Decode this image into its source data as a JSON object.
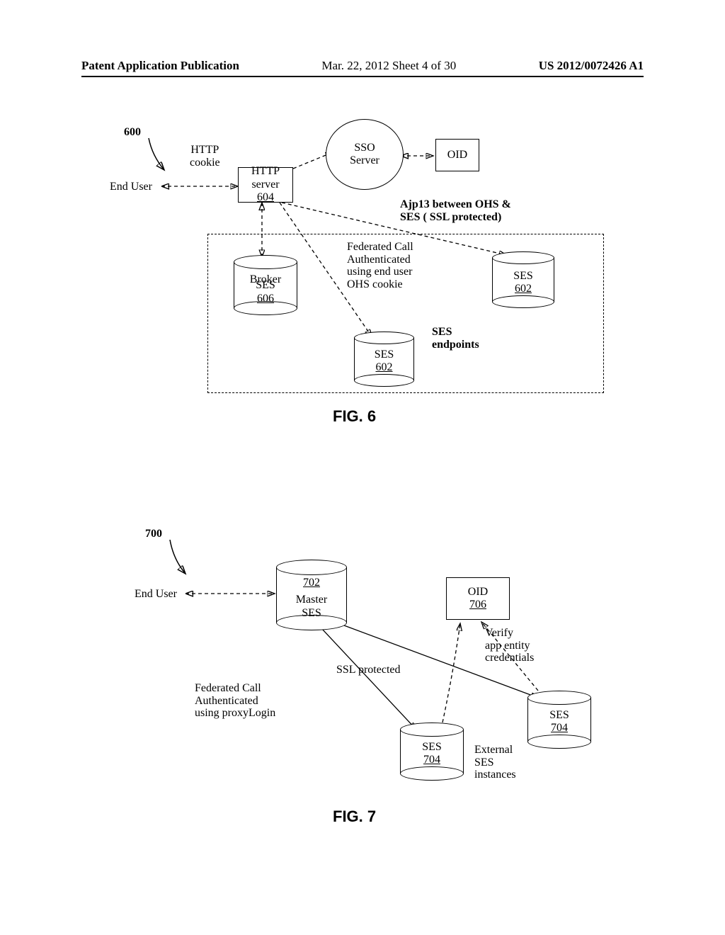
{
  "header": {
    "left": "Patent Application Publication",
    "mid": "Mar. 22, 2012  Sheet 4 of 30",
    "right": "US 2012/0072426 A1"
  },
  "fig6": {
    "num": "600",
    "end_user": "End User",
    "http_cookie": "HTTP\ncookie",
    "http_server_top": "HTTP",
    "http_server_mid": "server",
    "http_server_ref": "604",
    "sso_server": "SSO\nServer",
    "oid": "OID",
    "ajp": "Ajp13 between OHS &\nSES ( SSL protected)",
    "fed": "Federated Call\nAuthenticated\nusing end user\nOHS cookie",
    "broker_top": "Broker",
    "broker_mid": "SES",
    "broker_ref": "606",
    "ses_label": "SES",
    "ses_ref": "602",
    "ses_endpoints": "SES\nendpoints",
    "caption": "FIG. 6"
  },
  "fig7": {
    "num": "700",
    "end_user": "End User",
    "master_ref": "702",
    "master_mid": "Master",
    "master_bot": "SES",
    "oid_label": "OID",
    "oid_ref": "706",
    "verify": "Verify\napp entity\ncredentials",
    "ssl": "SSL protected",
    "fed": "Federated Call\nAuthenticated\nusing proxyLogin",
    "ses_label": "SES",
    "ses_ref": "704",
    "external": "External\nSES\ninstances",
    "caption": "FIG. 7"
  }
}
